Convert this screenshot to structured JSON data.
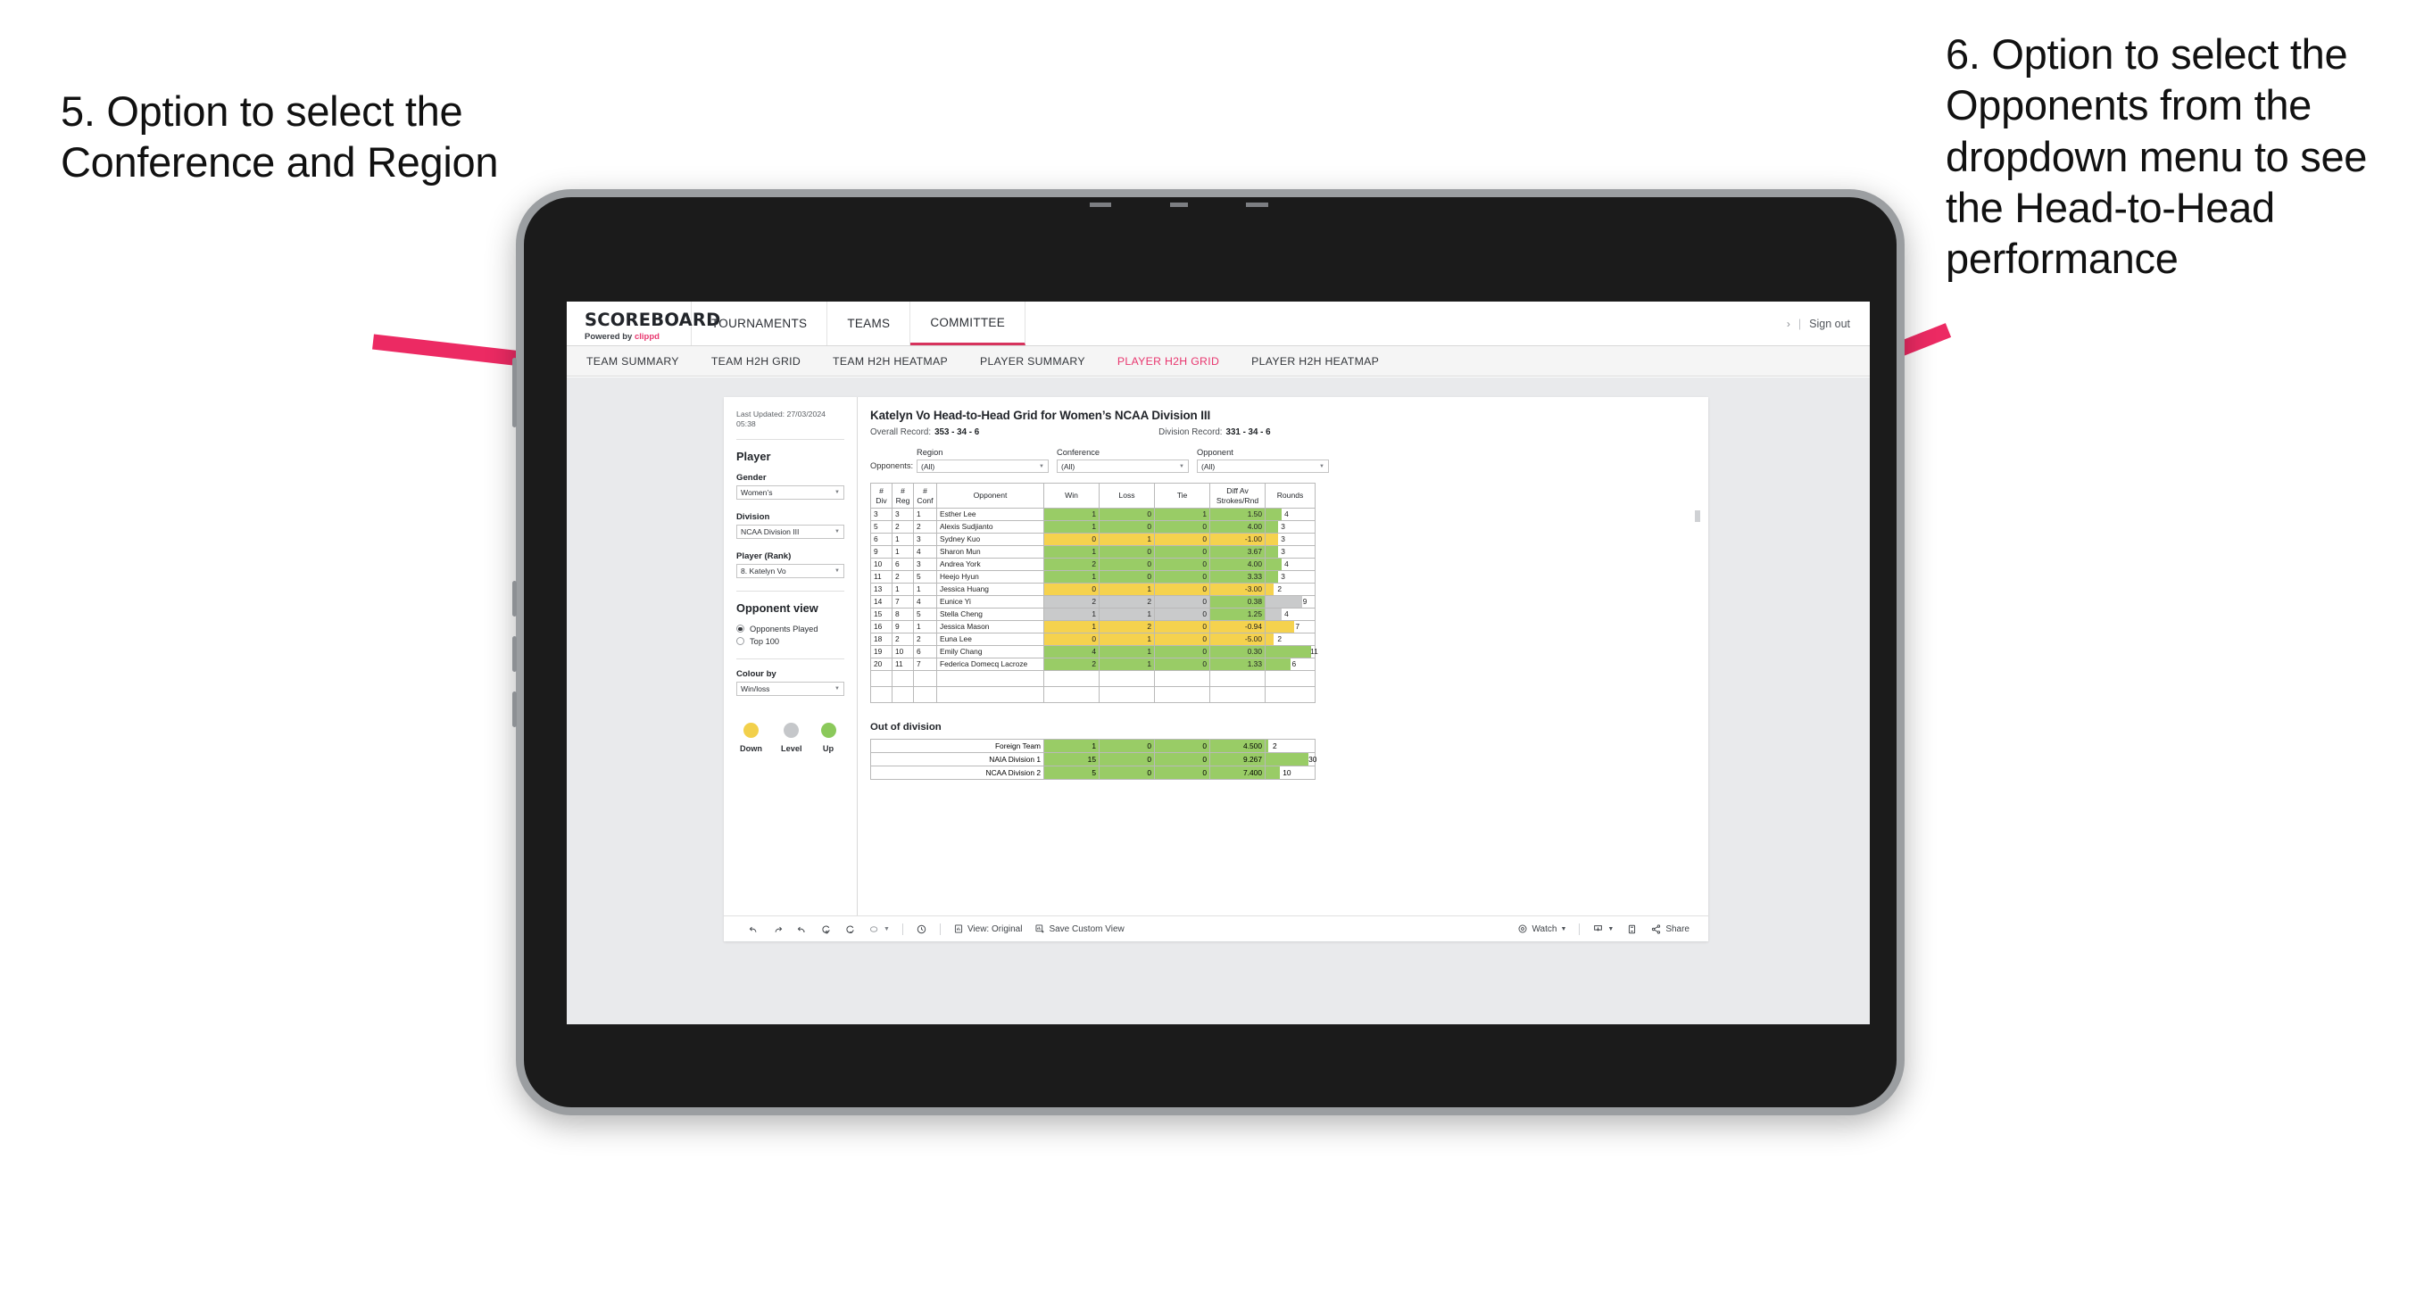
{
  "annotations": {
    "left": "5. Option to select the Conference and Region",
    "right": "6. Option to select the Opponents from the dropdown menu to see the Head-to-Head performance"
  },
  "topnav": {
    "logo": "SCOREBOARD",
    "powered_prefix": "Powered by ",
    "powered_brand": "clippd",
    "items": [
      {
        "label": "TOURNAMENTS",
        "active": false
      },
      {
        "label": "TEAMS",
        "active": false
      },
      {
        "label": "COMMITTEE",
        "active": true
      }
    ],
    "chevron": "›",
    "separator": "|",
    "signout": "Sign out"
  },
  "subnav": {
    "items": [
      {
        "label": "TEAM SUMMARY",
        "active": false
      },
      {
        "label": "TEAM H2H GRID",
        "active": false
      },
      {
        "label": "TEAM H2H HEATMAP",
        "active": false
      },
      {
        "label": "PLAYER SUMMARY",
        "active": false
      },
      {
        "label": "PLAYER H2H GRID",
        "active": true
      },
      {
        "label": "PLAYER H2H HEATMAP",
        "active": false
      }
    ]
  },
  "sidebar": {
    "last_updated": "Last Updated: 27/03/2024 05:38",
    "player_section_title": "Player",
    "gender": {
      "label": "Gender",
      "value": "Women’s"
    },
    "division": {
      "label": "Division",
      "value": "NCAA Division III"
    },
    "player_rank": {
      "label": "Player (Rank)",
      "value": "8. Katelyn Vo"
    },
    "opponent_view": {
      "title": "Opponent view",
      "options": [
        {
          "label": "Opponents Played",
          "selected": true
        },
        {
          "label": "Top 100",
          "selected": false
        }
      ]
    },
    "colour_by": {
      "label": "Colour by",
      "value": "Win/loss"
    },
    "legend": [
      {
        "label": "Down",
        "color": "#f2d04b"
      },
      {
        "label": "Level",
        "color": "#c5c7ca"
      },
      {
        "label": "Up",
        "color": "#8bc95b"
      }
    ]
  },
  "main": {
    "title": "Katelyn Vo Head-to-Head Grid for Women’s NCAA Division III",
    "overall_record_label": "Overall Record:",
    "overall_record_value": "353 - 34 - 6",
    "division_record_label": "Division Record:",
    "division_record_value": "331 - 34 - 6",
    "filters": {
      "prefix_label": "Opponents:",
      "region": {
        "label": "Region",
        "value": "(All)"
      },
      "conference": {
        "label": "Conference",
        "value": "(All)"
      },
      "opponent": {
        "label": "Opponent",
        "value": "(All)"
      }
    },
    "out_of_division_title": "Out of division"
  },
  "chart_data": {
    "type": "table",
    "title": "Katelyn Vo Head-to-Head Grid for Women’s NCAA Division III",
    "columns": [
      "# Div",
      "# Reg",
      "# Conf",
      "Opponent",
      "Win",
      "Loss",
      "Tie",
      "Diff Av Strokes/Rnd",
      "Rounds"
    ],
    "column_headers_multiline": [
      [
        "#",
        "Div"
      ],
      [
        "#",
        "Reg"
      ],
      [
        "#",
        "Conf"
      ],
      [
        "Opponent"
      ],
      [
        "Win"
      ],
      [
        "Loss"
      ],
      [
        "Tie"
      ],
      [
        "Diff Av",
        "Strokes/Rnd"
      ],
      [
        "Rounds"
      ]
    ],
    "rounds_max": 12,
    "rows": [
      {
        "div": "3",
        "reg": "3",
        "conf": "1",
        "opponent": "Esther Lee",
        "win": "1",
        "loss": "0",
        "tie": "1",
        "diff": "1.50",
        "rounds": "4",
        "state": "up"
      },
      {
        "div": "5",
        "reg": "2",
        "conf": "2",
        "opponent": "Alexis Sudjianto",
        "win": "1",
        "loss": "0",
        "tie": "0",
        "diff": "4.00",
        "rounds": "3",
        "state": "up"
      },
      {
        "div": "6",
        "reg": "1",
        "conf": "3",
        "opponent": "Sydney Kuo",
        "win": "0",
        "loss": "1",
        "tie": "0",
        "diff": "-1.00",
        "rounds": "3",
        "state": "down"
      },
      {
        "div": "9",
        "reg": "1",
        "conf": "4",
        "opponent": "Sharon Mun",
        "win": "1",
        "loss": "0",
        "tie": "0",
        "diff": "3.67",
        "rounds": "3",
        "state": "up"
      },
      {
        "div": "10",
        "reg": "6",
        "conf": "3",
        "opponent": "Andrea York",
        "win": "2",
        "loss": "0",
        "tie": "0",
        "diff": "4.00",
        "rounds": "4",
        "state": "up"
      },
      {
        "div": "11",
        "reg": "2",
        "conf": "5",
        "opponent": "Heejo Hyun",
        "win": "1",
        "loss": "0",
        "tie": "0",
        "diff": "3.33",
        "rounds": "3",
        "state": "up"
      },
      {
        "div": "13",
        "reg": "1",
        "conf": "1",
        "opponent": "Jessica Huang",
        "win": "0",
        "loss": "1",
        "tie": "0",
        "diff": "-3.00",
        "rounds": "2",
        "state": "down"
      },
      {
        "div": "14",
        "reg": "7",
        "conf": "4",
        "opponent": "Eunice Yi",
        "win": "2",
        "loss": "2",
        "tie": "0",
        "diff": "0.38",
        "rounds": "9",
        "state": "level",
        "diff_state": "up"
      },
      {
        "div": "15",
        "reg": "8",
        "conf": "5",
        "opponent": "Stella Cheng",
        "win": "1",
        "loss": "1",
        "tie": "0",
        "diff": "1.25",
        "rounds": "4",
        "state": "level",
        "diff_state": "up"
      },
      {
        "div": "16",
        "reg": "9",
        "conf": "1",
        "opponent": "Jessica Mason",
        "win": "1",
        "loss": "2",
        "tie": "0",
        "diff": "-0.94",
        "rounds": "7",
        "state": "down"
      },
      {
        "div": "18",
        "reg": "2",
        "conf": "2",
        "opponent": "Euna Lee",
        "win": "0",
        "loss": "1",
        "tie": "0",
        "diff": "-5.00",
        "rounds": "2",
        "state": "down"
      },
      {
        "div": "19",
        "reg": "10",
        "conf": "6",
        "opponent": "Emily Chang",
        "win": "4",
        "loss": "1",
        "tie": "0",
        "diff": "0.30",
        "rounds": "11",
        "state": "up"
      },
      {
        "div": "20",
        "reg": "11",
        "conf": "7",
        "opponent": "Federica Domecq Lacroze",
        "win": "2",
        "loss": "1",
        "tie": "0",
        "diff": "1.33",
        "rounds": "6",
        "state": "up"
      }
    ],
    "out_of_division": {
      "title": "Out of division",
      "rounds_max": 34,
      "rows": [
        {
          "name": "Foreign Team",
          "win": "1",
          "loss": "0",
          "tie": "0",
          "diff": "4.500",
          "rounds": "2",
          "state": "up"
        },
        {
          "name": "NAIA Division 1",
          "win": "15",
          "loss": "0",
          "tie": "0",
          "diff": "9.267",
          "rounds": "30",
          "state": "up"
        },
        {
          "name": "NCAA Division 2",
          "win": "5",
          "loss": "0",
          "tie": "0",
          "diff": "7.400",
          "rounds": "10",
          "state": "up"
        }
      ]
    }
  },
  "toolbar": {
    "view_label": "View: Original",
    "save_label": "Save Custom View",
    "watch_label": "Watch",
    "share_label": "Share"
  },
  "colors": {
    "accent": "#e8376f",
    "up": "#99cc66",
    "down": "#f5d24e",
    "level": "#c9cacb",
    "arrow": "#ec2a63"
  }
}
